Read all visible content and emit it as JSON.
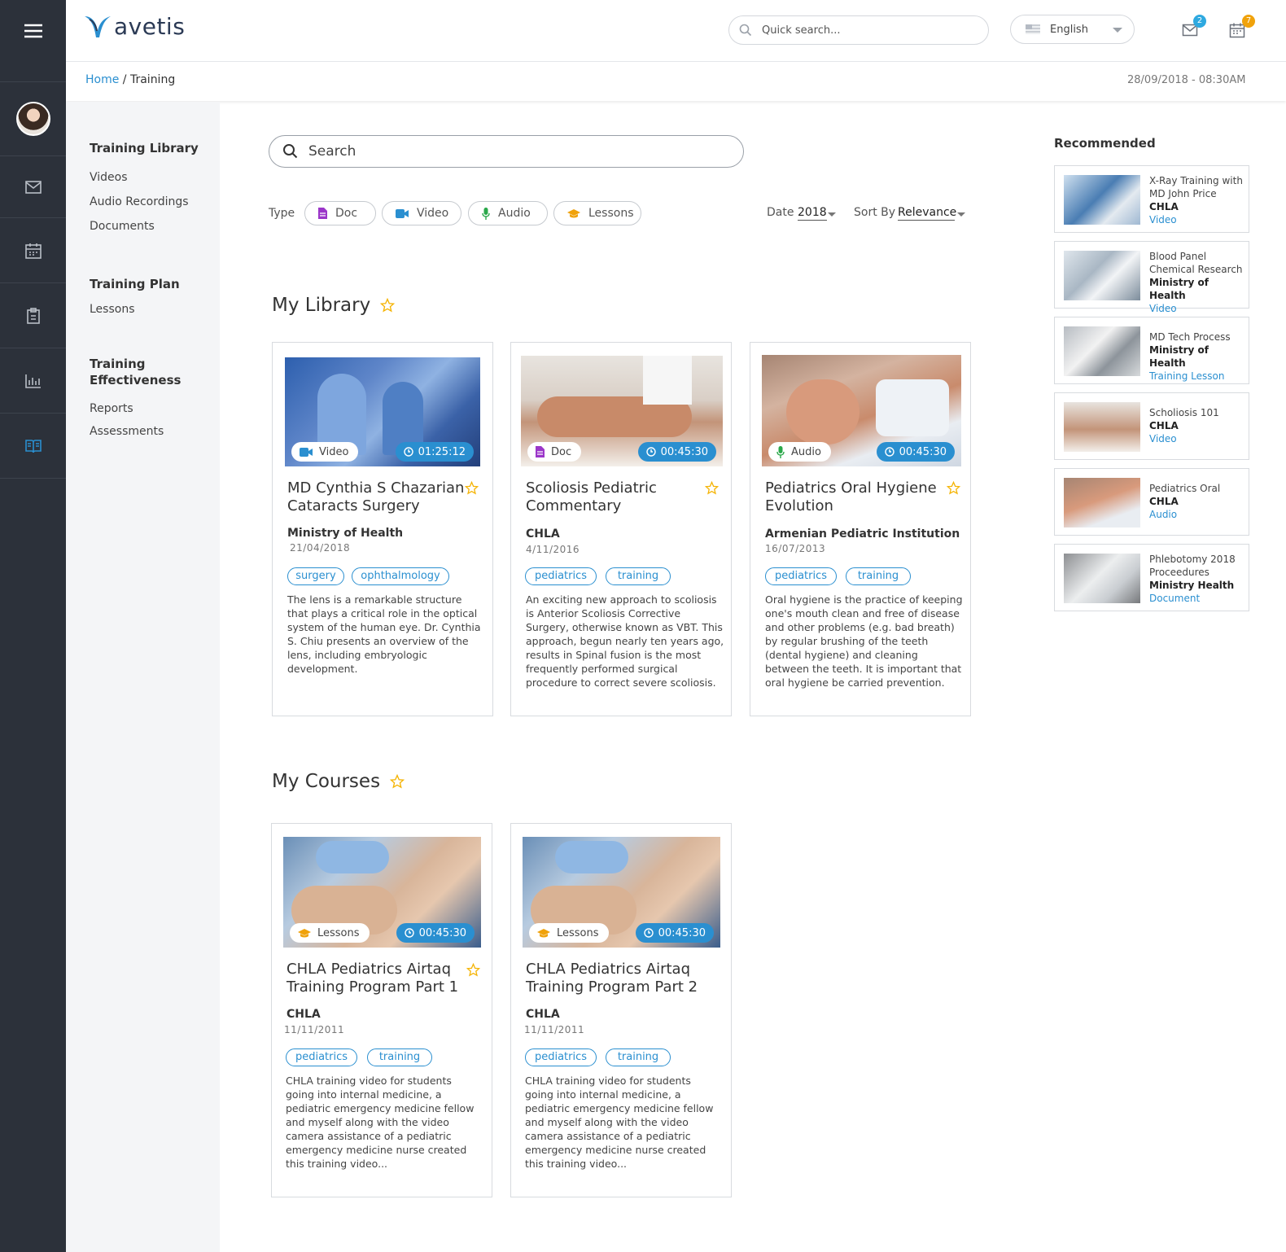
{
  "colors": {
    "accent": "#2a8fd0",
    "star": "#f5b301",
    "rail": "#2c313a",
    "video_icon": "#2a8fd0",
    "doc_icon": "#9b36c9",
    "audio_icon": "#2aa84a",
    "lessons_icon": "#f0a20b"
  },
  "header": {
    "logo_text": "avetis",
    "quick_search_placeholder": "Quick search...",
    "language": "English",
    "mail_count": "2",
    "calendar_count": "7"
  },
  "breadcrumb": {
    "home": "Home",
    "separator": " / ",
    "current": "Training"
  },
  "datetime": "28/09/2018 - 08:30AM",
  "sidenav": {
    "library_head": "Training Library",
    "library_items": [
      "Videos",
      "Audio Recordings",
      "Documents"
    ],
    "plan_head": "Training Plan",
    "plan_items": [
      "Lessons"
    ],
    "effect_head_1": "Training",
    "effect_head_2": "Effectiveness",
    "effect_items": [
      "Reports",
      "Assessments"
    ]
  },
  "search": {
    "placeholder": "Search"
  },
  "filters": {
    "type_label": "Type",
    "chips": [
      "Doc",
      "Video",
      "Audio",
      "Lessons"
    ],
    "date_label": "Date",
    "date_value": "2018",
    "sort_label": "Sort By",
    "sort_value": "Relevance"
  },
  "library": {
    "title": "My Library",
    "cards": [
      {
        "type": "Video",
        "duration": "01:25:12",
        "title_1": "MD Cynthia S Chazarian",
        "title_2": "Cataracts Surgery",
        "org": "Ministry of Health",
        "date": "21/04/2018",
        "tags": [
          "surgery",
          "ophthalmology"
        ],
        "desc": [
          "The lens is a remarkable structure",
          "that plays a critical role in the optical",
          "system of the human eye. Dr. Cynthia",
          "S. Chiu presents an overview of the",
          "lens, including embryologic",
          "development."
        ]
      },
      {
        "type": "Doc",
        "duration": "00:45:30",
        "title_1": "Scoliosis Pediatric",
        "title_2": "Commentary",
        "org": "CHLA",
        "date": "4/11/2016",
        "tags": [
          "pediatrics",
          "training"
        ],
        "desc": [
          "An exciting new approach to scoliosis",
          "is Anterior Scoliosis Corrective",
          "Surgery, otherwise known as VBT. This",
          "approach, begun nearly ten years ago,",
          "results in Spinal fusion is the most",
          "frequently performed surgical",
          "procedure to correct severe scoliosis."
        ]
      },
      {
        "type": "Audio",
        "duration": "00:45:30",
        "title_1": "Pediatrics Oral Hygiene",
        "title_2": "Evolution",
        "org": "Armenian Pediatric Institution",
        "date": "16/07/2013",
        "tags": [
          "pediatrics",
          "training"
        ],
        "desc": [
          "Oral hygiene is the practice of keeping",
          "one's mouth clean and free of disease",
          "and other problems (e.g. bad breath)",
          "by regular brushing of the teeth",
          "(dental hygiene) and cleaning",
          "between the teeth. It is important that",
          "oral hygiene be carried prevention."
        ]
      }
    ]
  },
  "courses": {
    "title": "My Courses",
    "cards": [
      {
        "type": "Lessons",
        "duration": "00:45:30",
        "title_1": "CHLA Pediatrics Airtaq",
        "title_2": "Training Program Part 1",
        "org": "CHLA",
        "date": "11/11/2011",
        "tags": [
          "pediatrics",
          "training"
        ],
        "desc": [
          "CHLA training video for students",
          "going into internal medicine, a",
          "pediatric emergency medicine fellow",
          "and myself along with the video",
          "camera assistance of a pediatric",
          "emergency medicine nurse created",
          "this training video..."
        ]
      },
      {
        "type": "Lessons",
        "duration": "00:45:30",
        "title_1": "CHLA Pediatrics Airtaq",
        "title_2": "Training Program Part 2",
        "org": "CHLA",
        "date": "11/11/2011",
        "tags": [
          "pediatrics",
          "training"
        ],
        "desc": [
          "CHLA training video for students",
          "going into internal medicine, a",
          "pediatric emergency medicine fellow",
          "and myself along with the video",
          "camera assistance of a pediatric",
          "emergency medicine nurse created",
          "this training video..."
        ]
      }
    ]
  },
  "recommended": {
    "title": "Recommended",
    "items": [
      {
        "l1": "X-Ray Training with",
        "l2": "MD John Price",
        "org": "CHLA",
        "type": "Video"
      },
      {
        "l1": "Blood Panel",
        "l2": "Chemical Research",
        "org": "Ministry of Health",
        "type": "Video"
      },
      {
        "l1": "MD Tech Process",
        "l2": "",
        "org": "Ministry of Health",
        "type": "Training Lesson"
      },
      {
        "l1": "Scholiosis 101",
        "l2": "",
        "org": "CHLA",
        "type": "Video"
      },
      {
        "l1": "Pediatrics Oral",
        "l2": "",
        "org": "CHLA",
        "type": "Audio"
      },
      {
        "l1": "Phlebotomy 2018",
        "l2": "Proceedures",
        "org": "Ministry Health",
        "type": "Document"
      }
    ]
  }
}
